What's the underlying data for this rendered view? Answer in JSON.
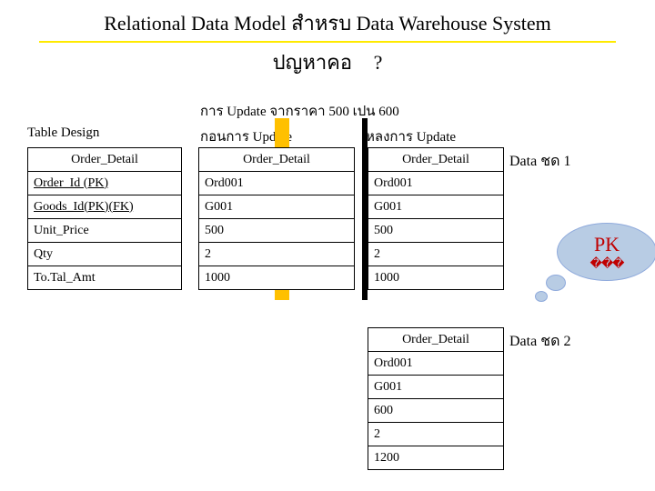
{
  "title": "Relational Data Model สำหรบ       Data Warehouse System",
  "subtitle_left": "ปญหาคอ",
  "subtitle_q": "?",
  "update_line": "การ Update จากราคา 500 เปน     600",
  "labels": {
    "table_design": "Table Design",
    "before": "กอนการ    Update",
    "after": "หลงการ    Update",
    "data_set_1": "Data ชด     1",
    "data_set_2": "Data ชด     2"
  },
  "fields": {
    "header": "Order_Detail",
    "order_id": "Order_Id (PK)",
    "goods_id": "Goods_Id(PK)(FK)",
    "unit_price": "Unit_Price",
    "qty": "Qty",
    "total_amt": "To.Tal_Amt"
  },
  "before": {
    "header": "Order_Detail",
    "order_id": "Ord001",
    "goods_id": "G001",
    "unit_price": "500",
    "qty": "2",
    "total_amt": "1000"
  },
  "after": {
    "header": "Order_Detail",
    "order_id": "Ord001",
    "goods_id": "G001",
    "unit_price": "500",
    "qty": "2",
    "total_amt": "1000"
  },
  "set2": {
    "header": "Order_Detail",
    "order_id": "Ord001",
    "goods_id": "G001",
    "unit_price": "600",
    "qty": "2",
    "total_amt": "1200"
  },
  "callout": {
    "pk": "PK",
    "boxes": "���"
  }
}
